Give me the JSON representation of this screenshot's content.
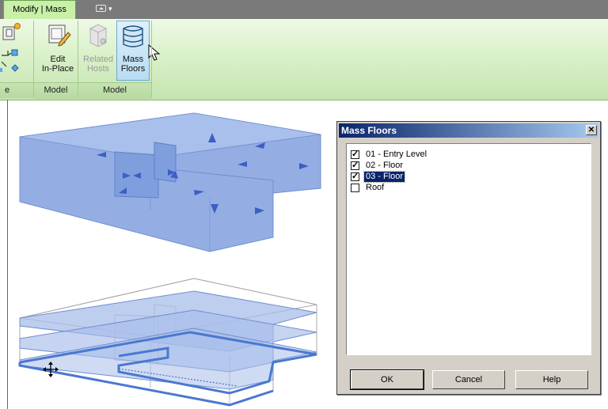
{
  "ribbon_tab": {
    "label": "Modify | Mass"
  },
  "ribbon": {
    "buttons": [
      {
        "label_line1": "Edit",
        "label_line2": "In-Place"
      },
      {
        "label_line1": "Related",
        "label_line2": "Hosts"
      },
      {
        "label_line1": "Mass",
        "label_line2": "Floors"
      }
    ],
    "panels": {
      "left_partial": "e",
      "model_1": "Model",
      "model_2": "Model"
    }
  },
  "dialog": {
    "title": "Mass Floors",
    "close_glyph": "✕",
    "items": [
      {
        "label": "01 - Entry Level",
        "checked": true,
        "selected": false,
        "check_glyph": "✓"
      },
      {
        "label": "02 - Floor",
        "checked": true,
        "selected": false,
        "check_glyph": "✓"
      },
      {
        "label": "03 - Floor",
        "checked": true,
        "selected": true,
        "check_glyph": "✓"
      },
      {
        "label": "Roof",
        "checked": false,
        "selected": false,
        "check_glyph": ""
      }
    ],
    "ok": "OK",
    "cancel": "Cancel",
    "help": "Help"
  },
  "colors": {
    "ribbon_active_tab": "#c9f0a8",
    "mass_fill": "#8aa8e0",
    "floor_edge": "#4a78d0",
    "dialog_title": "#0a246a"
  }
}
